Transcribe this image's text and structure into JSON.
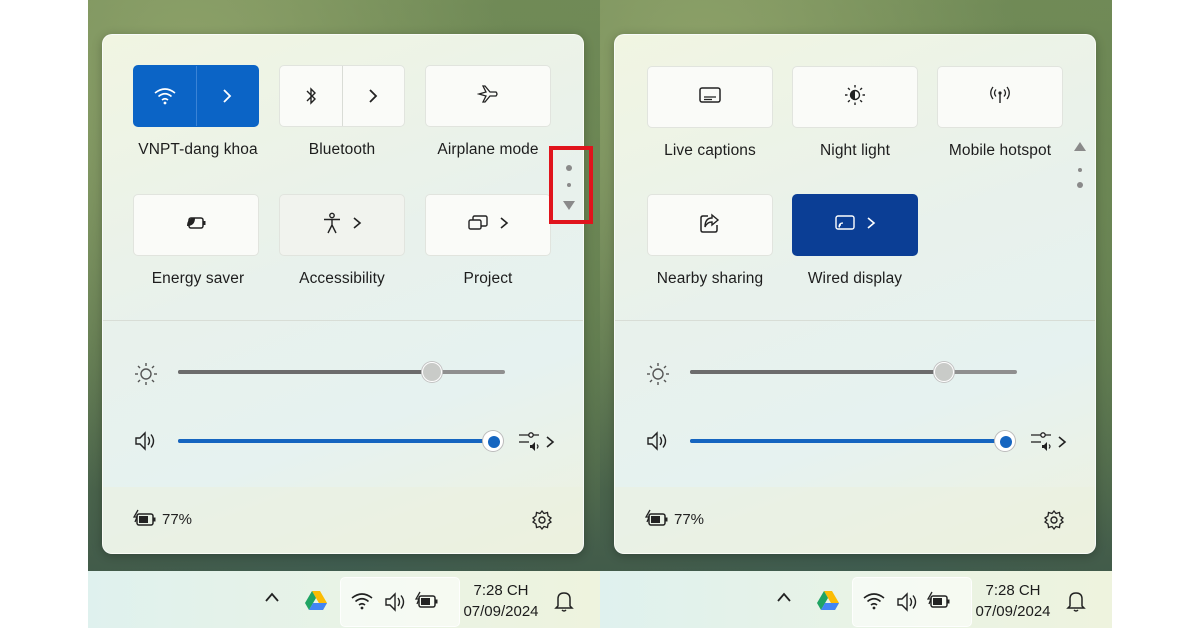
{
  "left_panel": {
    "tiles": [
      {
        "label": "VNPT-dang khoa",
        "icon": "wifi-icon",
        "state": "on",
        "has_arrow": true
      },
      {
        "label": "Bluetooth",
        "icon": "bluetooth-icon",
        "state": "off",
        "has_arrow": true
      },
      {
        "label": "Airplane mode",
        "icon": "airplane-icon",
        "state": "off",
        "has_arrow": false
      },
      {
        "label": "Energy saver",
        "icon": "energy-saver-icon",
        "state": "off",
        "has_arrow": false
      },
      {
        "label": "Accessibility",
        "icon": "accessibility-icon",
        "state": "off",
        "has_arrow": true
      },
      {
        "label": "Project",
        "icon": "project-icon",
        "state": "off",
        "has_arrow": true
      }
    ],
    "brightness_level": 0.78,
    "volume_level": 1.0,
    "battery_percent": "77%",
    "scroll_indicator": "page 1 of 2",
    "highlight_color": "#e0141c"
  },
  "right_panel": {
    "tiles": [
      {
        "label": "Live captions",
        "icon": "live-captions-icon",
        "state": "off",
        "has_arrow": false
      },
      {
        "label": "Night light",
        "icon": "night-light-icon",
        "state": "off",
        "has_arrow": false
      },
      {
        "label": "Mobile hotspot",
        "icon": "mobile-hotspot-icon",
        "state": "off",
        "has_arrow": false
      },
      {
        "label": "Nearby sharing",
        "icon": "nearby-sharing-icon",
        "state": "off",
        "has_arrow": false
      },
      {
        "label": "Wired display",
        "icon": "wired-display-icon",
        "state": "on",
        "has_arrow": true
      }
    ],
    "brightness_level": 0.78,
    "volume_level": 1.0,
    "battery_percent": "77%",
    "scroll_indicator": "page 2 of 2"
  },
  "taskbar": {
    "time": "7:28 CH",
    "date": "07/09/2024",
    "tray_icons": [
      "chevron-up-icon",
      "google-drive-icon",
      "wifi-icon",
      "speaker-icon",
      "battery-icon",
      "bell-icon"
    ]
  },
  "colors": {
    "accent_blue": "#0b64c6",
    "accent_dark_blue": "#0b3e95",
    "slider_blue": "#1565c0"
  }
}
